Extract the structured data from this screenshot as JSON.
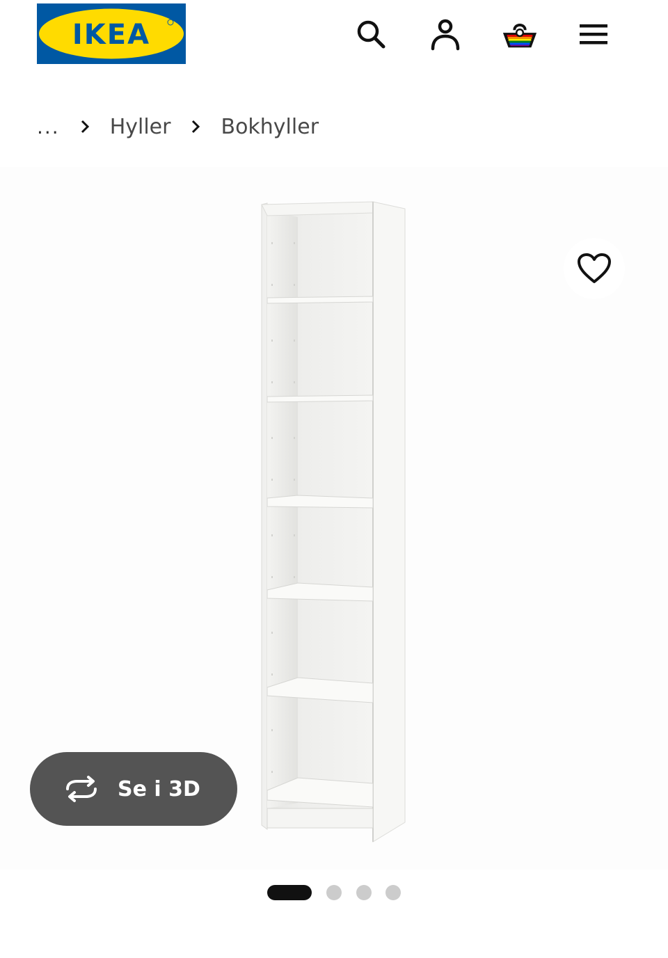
{
  "header": {
    "logo_text": "IKEA",
    "icons": [
      "search-icon",
      "account-icon",
      "shopping-basket-icon",
      "menu-icon"
    ]
  },
  "breadcrumb": {
    "ellipsis": "...",
    "items": [
      "Hyller",
      "Bokhyller"
    ]
  },
  "gallery": {
    "view_3d_label": "Se i 3D",
    "image_count": 4,
    "active_index": 0
  },
  "colors": {
    "brand_blue": "#0058a3",
    "brand_yellow": "#ffdb00",
    "button_dark": "#545454"
  }
}
